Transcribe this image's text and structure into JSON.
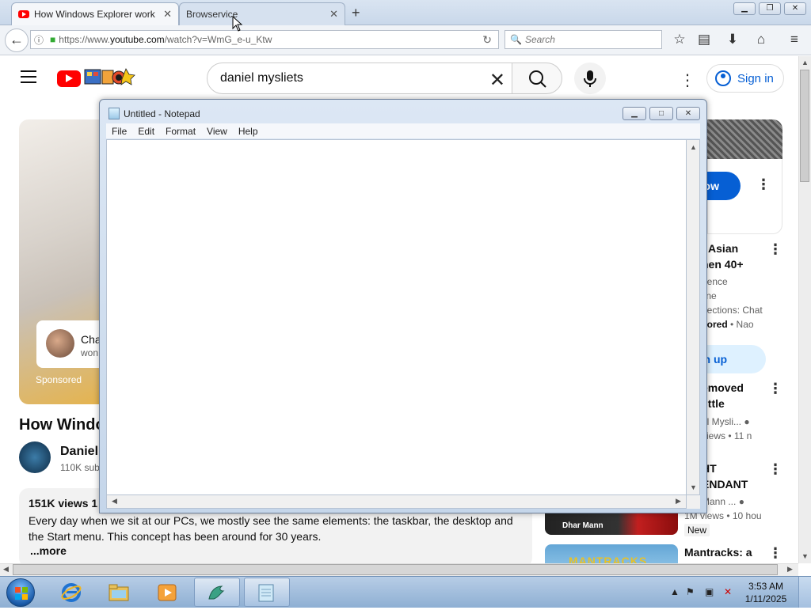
{
  "browser": {
    "tabs": [
      {
        "label": "How Windows Explorer work",
        "active": true
      },
      {
        "label": "Browservice",
        "active": false
      }
    ],
    "url_prefix": "https://www.",
    "url_host": "youtube.com",
    "url_path": "/watch?v=WmG_e-u_Ktw",
    "search_placeholder": "Search"
  },
  "youtube": {
    "search_query": "daniel mysliets",
    "sign_in": "Sign in",
    "ad_title": "Cha",
    "ad_sub": "won",
    "sponsored": "Sponsored",
    "video_title": "How Windo",
    "channel_name": "Daniel",
    "channel_subs": "110K sub",
    "views": "151K views  1",
    "description": "Every day when we sit at our PCs, we mostly see the same elements: the taskbar, the desktop and the Start menu. This concept has been around for 30 years.",
    "more": "...more",
    "sidebar": {
      "shop_now": "now",
      "ad2_title_l1": "t Asian",
      "ad2_title_l2": "nen 40+",
      "ad2_meta_l1": "rience",
      "ad2_meta_l2": "line",
      "ad2_meta_l3": "nections: Chat",
      "ad2_meta_l4_bold": "sored",
      "ad2_meta_l4_rest": " • Nao",
      "sign_up": "gn up",
      "v1_title_l1": "emoved",
      "v1_title_l2": "little",
      "v1_channel": "el Mysli...",
      "v1_meta": " views  • 11 n",
      "v2_title_l1": "HT",
      "v2_title_l2": "ENDANT",
      "v2_channel": "Mann ...",
      "v2_meta": "1M views  • 10 hou",
      "dhar_label": "Dhar Mann",
      "new_badge": "New",
      "v3_title": "Mantracks: a",
      "mantracks_thumb": "MANTRACKS"
    }
  },
  "notepad": {
    "title": "Untitled - Notepad",
    "menu": [
      "File",
      "Edit",
      "Format",
      "View",
      "Help"
    ],
    "content": ""
  },
  "taskbar": {
    "time": "3:53 AM",
    "date": "1/11/2025"
  },
  "colors": {
    "yt_red": "#ff0000",
    "yt_blue": "#065fd4"
  }
}
